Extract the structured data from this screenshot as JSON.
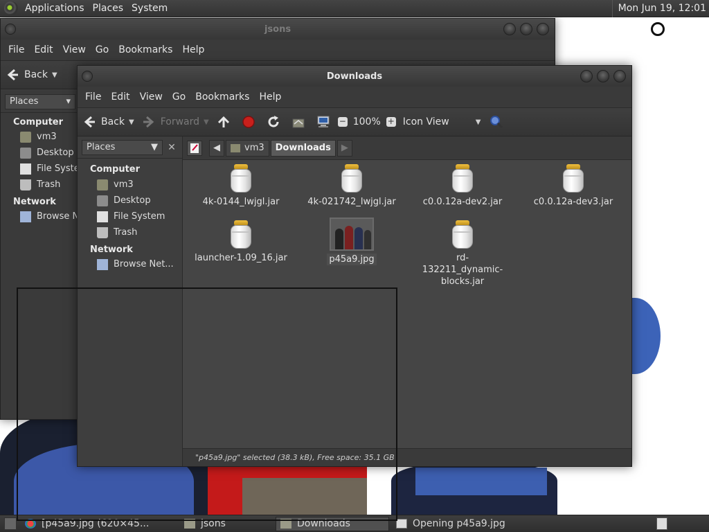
{
  "top_panel": {
    "menus": [
      "Applications",
      "Places",
      "System"
    ],
    "clock": "Mon Jun 19, 12:01"
  },
  "back_window": {
    "title": "jsons",
    "menu": [
      "File",
      "Edit",
      "View",
      "Go",
      "Bookmarks",
      "Help"
    ],
    "toolbar": {
      "back": "Back"
    },
    "sidebar": {
      "combo": "Places",
      "computer": "Computer",
      "items": [
        "vm3",
        "Desktop",
        "File Syster",
        "Trash"
      ],
      "network": "Network",
      "net_items": [
        "Browse Ne"
      ]
    }
  },
  "window": {
    "title": "Downloads",
    "menu": [
      "File",
      "Edit",
      "View",
      "Go",
      "Bookmarks",
      "Help"
    ],
    "toolbar": {
      "back": "Back",
      "forward": "Forward",
      "zoom": "100%",
      "view_mode": "Icon View"
    },
    "sidebar": {
      "combo": "Places",
      "computer": "Computer",
      "items": [
        "vm3",
        "Desktop",
        "File System",
        "Trash"
      ],
      "network": "Network",
      "net_items": [
        "Browse Net..."
      ]
    },
    "pathbar": [
      "vm3",
      "Downloads"
    ],
    "files": [
      {
        "name": "4k-0144_lwjgl.jar",
        "type": "jar"
      },
      {
        "name": "4k-021742_lwjgl.jar",
        "type": "jar"
      },
      {
        "name": "c0.0.12a-dev2.jar",
        "type": "jar"
      },
      {
        "name": "c0.0.12a-dev3.jar",
        "type": "jar"
      },
      {
        "name": "launcher-1.09_16.jar",
        "type": "jar"
      },
      {
        "name": "p45a9.jpg",
        "type": "image",
        "selected": true
      },
      {
        "name": "rd-132211_dynamic-blocks.jar",
        "type": "jar"
      }
    ],
    "status": "\"p45a9.jpg\" selected (38.3 kB), Free space: 35.1 GB"
  },
  "taskbar": {
    "items": [
      {
        "label": "[p45a9.jpg (620×45...",
        "icon": "image-viewer-icon"
      },
      {
        "label": "jsons",
        "icon": "folder-icon"
      },
      {
        "label": "Downloads",
        "icon": "folder-icon",
        "pressed": true
      },
      {
        "label": "Opening p45a9.jpg",
        "icon": "progress-icon"
      }
    ]
  },
  "colors": {
    "accent_jar_lid": "#d9a521",
    "panel": "#333333",
    "window_bg": "#3a3a3a"
  }
}
